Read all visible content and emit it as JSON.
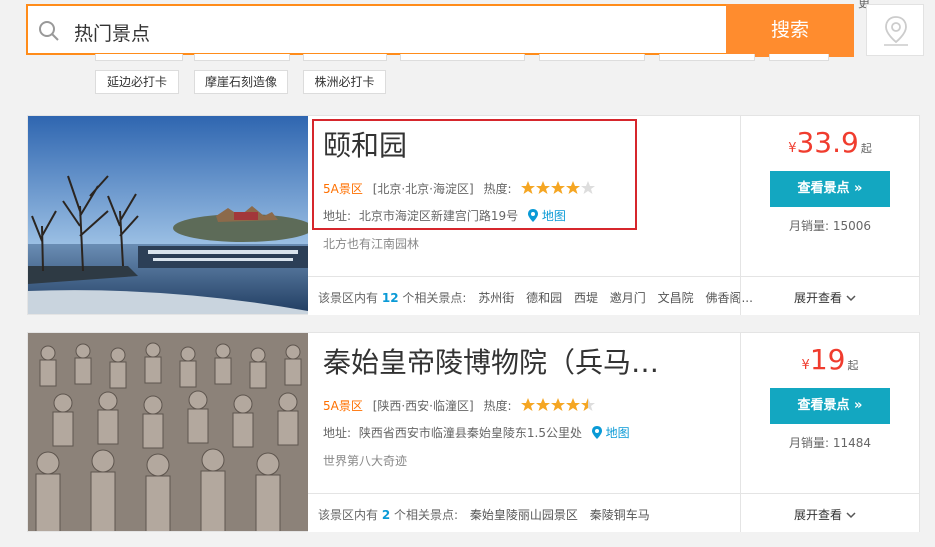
{
  "search": {
    "value": "热门景点",
    "button_label": "搜索"
  },
  "header": {
    "corner_text": "更"
  },
  "tags": [
    "延边必打卡",
    "摩崖石刻造像",
    "株洲必打卡"
  ],
  "results": [
    {
      "title": "颐和园",
      "level": "5A景区",
      "region": "[北京·北京·海淀区]",
      "heat_label": "热度:",
      "rating": 4,
      "address_label": "地址:",
      "address": "北京市海淀区新建宫门路19号",
      "map_label": "地图",
      "description": "北方也有江南园林",
      "price_currency": "¥",
      "price": "33.9",
      "price_suffix": "起",
      "view_button": "查看景点 »",
      "sales_label": "月销量:",
      "sales": "15006",
      "related_prefix": "该景区内有",
      "related_count": "12",
      "related_suffix": "个相关景点:",
      "related_spots": [
        "苏州街",
        "德和园",
        "西堤",
        "邀月门",
        "文昌院",
        "佛香阁..."
      ],
      "expand_label": "展开查看"
    },
    {
      "title": "秦始皇帝陵博物院（兵马…",
      "level": "5A景区",
      "region": "[陕西·西安·临潼区]",
      "heat_label": "热度:",
      "rating": 4.5,
      "address_label": "地址:",
      "address": "陕西省西安市临潼县秦始皇陵东1.5公里处",
      "map_label": "地图",
      "description": "世界第八大奇迹",
      "price_currency": "¥",
      "price": "19",
      "price_suffix": "起",
      "view_button": "查看景点 »",
      "sales_label": "月销量:",
      "sales": "11484",
      "related_prefix": "该景区内有",
      "related_count": "2",
      "related_suffix": "个相关景点:",
      "related_spots": [
        "秦始皇陵丽山园景区",
        "秦陵铜车马"
      ],
      "expand_label": "展开查看"
    }
  ],
  "colors": {
    "accent": "#ff8c2e",
    "button": "#13a7c1",
    "price": "#f03c2e",
    "level": "#ff7000",
    "highlight": "#d6262c"
  }
}
